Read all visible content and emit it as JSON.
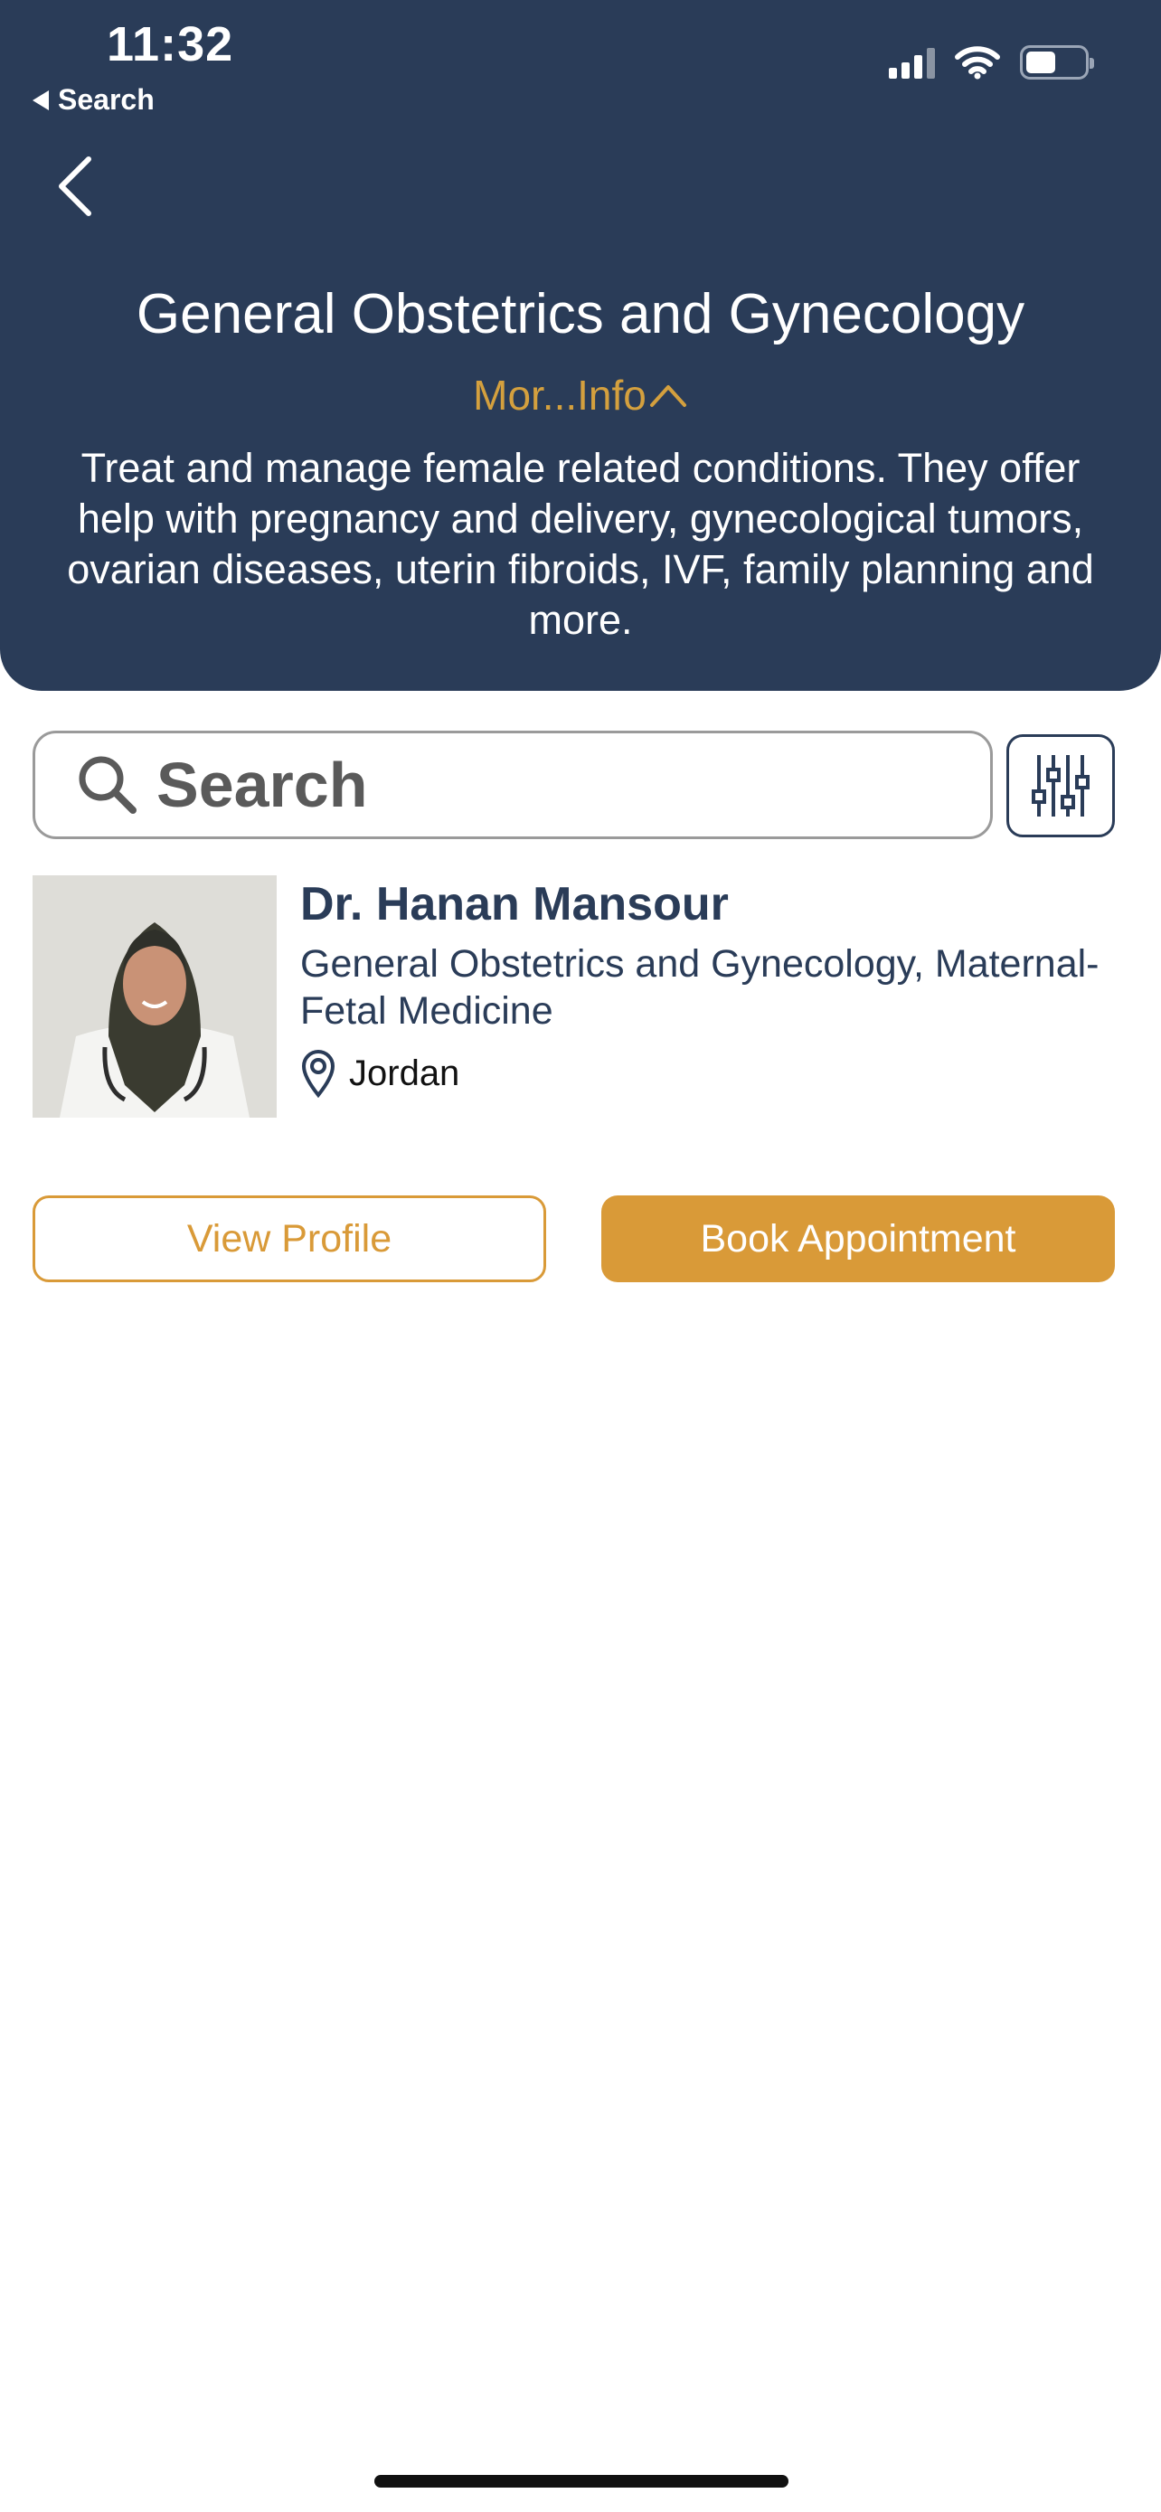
{
  "status_bar": {
    "time": "11:32",
    "back_app_label": "Search",
    "icons": [
      "cellular-signal-icon",
      "wifi-icon",
      "battery-icon"
    ]
  },
  "header": {
    "back_icon": "chevron-left-icon",
    "title": "General Obstetrics and Gynecology",
    "more_info_label": "Mor...Info",
    "more_info_icon": "chevron-up-icon",
    "description": "Treat and manage female related conditions. They offer help with pregnancy and delivery, gynecological tumors, ovarian diseases, uterin fibroids, IVF, family planning and more."
  },
  "search": {
    "placeholder": "Search",
    "icon": "search-icon",
    "filter_icon": "filter-sliders-icon"
  },
  "doctors": [
    {
      "name": "Dr. Hanan Mansour",
      "specialty": "General Obstetrics and Gynecology, Maternal-Fetal Medicine",
      "location": "Jordan",
      "location_icon": "location-pin-icon",
      "view_profile_label": "View Profile",
      "book_label": "Book Appointment"
    }
  ],
  "colors": {
    "header_bg": "#2a3c58",
    "accent": "#d99a38",
    "text_primary": "#2a3c58"
  }
}
